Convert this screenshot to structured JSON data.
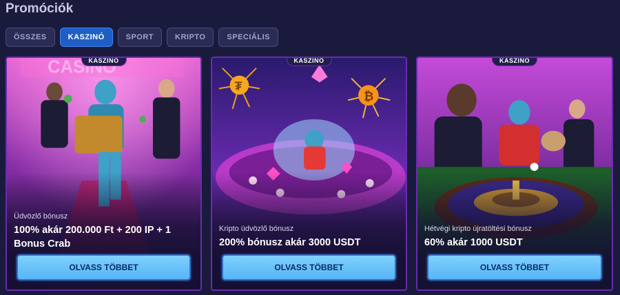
{
  "page": {
    "title": "Promóciók"
  },
  "tabs": [
    {
      "label": "ÖSSZES",
      "active": false
    },
    {
      "label": "KASZINÓ",
      "active": true
    },
    {
      "label": "SPORT",
      "active": false
    },
    {
      "label": "KRIPTO",
      "active": false
    },
    {
      "label": "SPECIÁLIS",
      "active": false
    }
  ],
  "cards": [
    {
      "badge": "KASZINÓ",
      "subtitle": "Üdvözlő bónusz",
      "headline": "100% akár 200.000 Ft + 200 IP + 1 Bonus Crab",
      "button": "OLVASS TÖBBET",
      "sign_text": "CASINO"
    },
    {
      "badge": "KASZINÓ",
      "subtitle": "Kripto üdvözlő bónusz",
      "headline": "200% bónusz akár 3000 USDT",
      "button": "OLVASS TÖBBET"
    },
    {
      "badge": "KASZINÓ",
      "subtitle": "Hétvégi kripto újratöltési bónusz",
      "headline": "60% akár 1000 USDT",
      "button": "OLVASS TÖBBET"
    }
  ],
  "colors": {
    "background": "#1a1a3d",
    "accent": "#1f5fc4",
    "card_border": "#6a2bb0",
    "button": "#56b6f5"
  }
}
